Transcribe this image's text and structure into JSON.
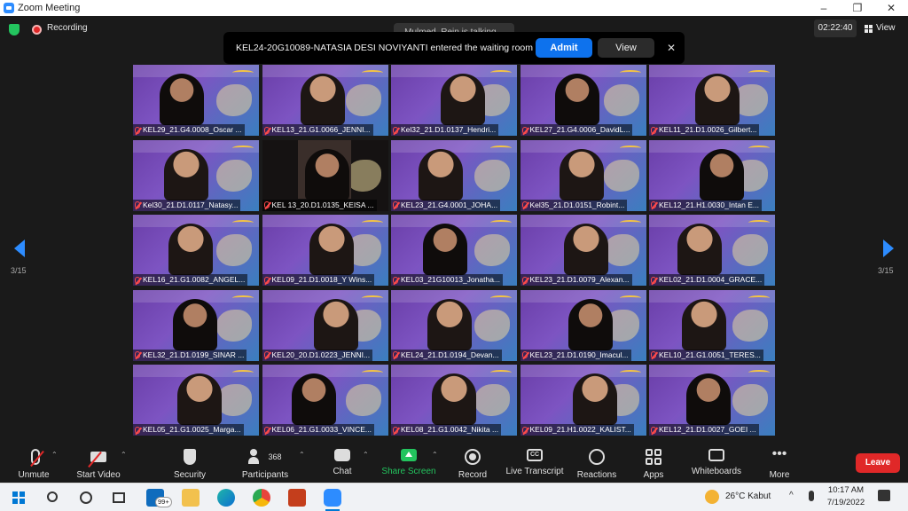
{
  "window": {
    "title": "Zoom Meeting",
    "controls": [
      "–",
      "❐",
      "✕"
    ]
  },
  "status": {
    "recording_label": "Recording",
    "timer": "02:22:40",
    "view_label": "View",
    "talking": "Mulmed_Rein is talking..."
  },
  "banner": {
    "message": "KEL24-20G10089-NATASIA DESI NOVIYANTI entered the waiting room",
    "admit_label": "Admit",
    "view_label": "View",
    "close_label": "✕"
  },
  "pagination": {
    "left": "3/15",
    "right": "3/15"
  },
  "participants": [
    "KEL29_21.G4.0008_Oscar ...",
    "KEL13_21.G1.0066_JENNI...",
    "Kel32_21.D1.0137_Hendri...",
    "KEL27_21.G4.0006_DavidL...",
    "KEL11_21.D1.0026_Gilbert...",
    "Kel30_21.D1.0117_Natasy...",
    "KEL 13_20.D1.0135_KEISA ...",
    "KEL23_21.G4.0001_JOHA...",
    "Kel35_21.D1.0151_Robint...",
    "KEL12_21.H1.0030_Intan E...",
    "KEL16_21.G1.0082_ANGEL...",
    "KEL09_21.D1.0018_Y Wins...",
    "KEL03_21G10013_Jonatha...",
    "KEL23_21.D1.0079_Alexan...",
    "KEL02_21.D1.0004_GRACE...",
    "KEL32_21.D1.0199_SINAR ...",
    "KEL20_20.D1.0223_JENNI...",
    "KEL24_21.D1.0194_Devan...",
    "KEL23_21.D1.0190_Imacul...",
    "KEL10_21.G1.0051_TERES...",
    "KEL05_21.G1.0025_Marga...",
    "KEL06_21.G1.0033_VINCE...",
    "KEL08_21.G1.0042_Nikita ...",
    "KEL09_21.H1.0022_KALIST...",
    "KEL12_21.D1.0027_GOEI ..."
  ],
  "toolbar": {
    "unmute": "Unmute",
    "start_video": "Start Video",
    "security": "Security",
    "participants": "Participants",
    "participants_count": "368",
    "chat": "Chat",
    "share_screen": "Share Screen",
    "record": "Record",
    "live_transcript": "Live Transcript",
    "cc_text": "CC",
    "reactions": "Reactions",
    "apps": "Apps",
    "whiteboards": "Whiteboards",
    "more": "More",
    "more_dots": "•••",
    "leave": "Leave"
  },
  "taskbar": {
    "mail_badge": "99+",
    "weather": "26°C  Kabut",
    "time": "10:17 AM",
    "date": "7/19/2022"
  },
  "colors": {
    "accent": "#2d8cff",
    "admit": "#0e72ed",
    "leave": "#e02828",
    "share": "#23c45e"
  }
}
